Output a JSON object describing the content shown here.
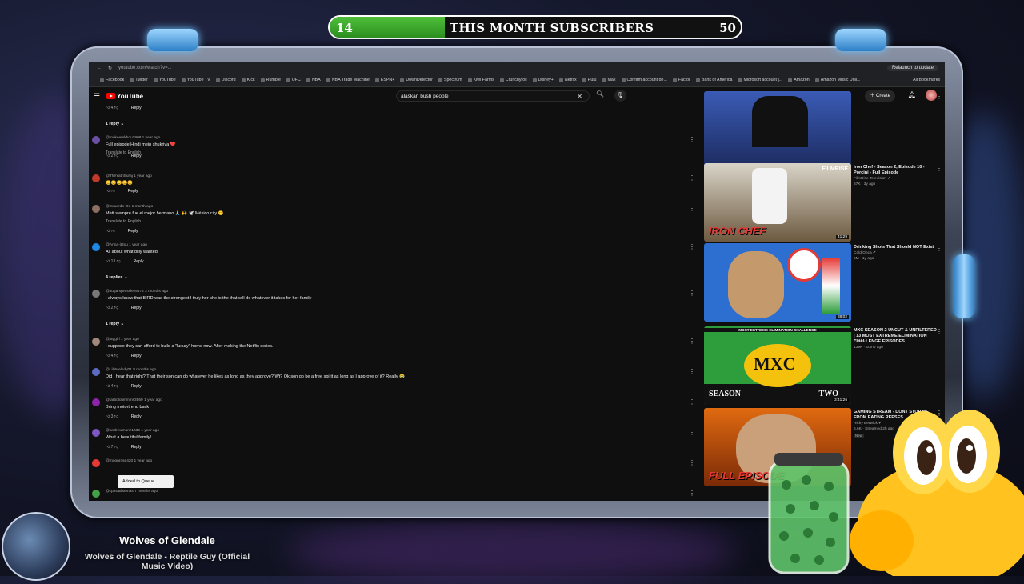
{
  "overlay": {
    "subscribers": {
      "current": "14",
      "title": "THIS MONTH SUBSCRIBERS",
      "goal": "50",
      "progress_fraction": 0.28
    },
    "now_playing": {
      "title": "Wolves of Glendale",
      "subtitle": "Wolves of Glendale - Reptile Guy (Official Music Video)"
    }
  },
  "browser": {
    "url": "youtube.com/watch?v=...",
    "relaunch_label": "Relaunch to update",
    "bookmarks": [
      "Facebook",
      "Twitter",
      "YouTube",
      "YouTube TV",
      "Discord",
      "Kick",
      "Rumble",
      "UFC",
      "NBA",
      "NBA Trade Machine",
      "ESPN+",
      "DownDetector",
      "Spectrum",
      "Kiwi Farms",
      "Crunchyroll",
      "Disney+",
      "Netflix",
      "Hulu",
      "Max",
      "Confirm account de...",
      "Factor",
      "Bank of America",
      "Microsoft account |...",
      "Amazon",
      "Amazon Music Unli..."
    ],
    "all_bookmarks_label": "All Bookmarks"
  },
  "youtube": {
    "logo": "YouTube",
    "search_value": "alaskan bush people",
    "create_label": "Create",
    "comments": [
      {
        "author": "",
        "text": "",
        "actions": "4",
        "reply": "Reply",
        "thread": "1 reply"
      },
      {
        "author": "@mokeemkhou1908  1 year ago",
        "text": "Full episode Hindi mein shukriya ❤️",
        "translate": "Translate to English",
        "actions": "2",
        "reply": "Reply",
        "av": "#6a4fa3"
      },
      {
        "author": "@TheYatriSuraj  1 year ago",
        "text": "😊😊😊😊😊",
        "actions": "",
        "reply": "Reply",
        "av": "#c0392b"
      },
      {
        "author": "@Eduardo-t9q  1 month ago",
        "text": "Matt siempre fue el mejor hermano 🙏 🙌 🕊️ México city 😊",
        "translate": "Translate to English",
        "actions": "",
        "reply": "Reply",
        "av": "#8d6e63"
      },
      {
        "author": "@Anna-jt2xu  1 year ago",
        "text": "All about what billy wanted",
        "actions": "13",
        "reply": "Reply",
        "av": "#1e88e5",
        "thread": "4 replies"
      },
      {
        "author": "@sugarspressley9472  2 months ago",
        "text": "I always knew that BIRD was the strongest  I truly her she is the that will do whatever it takes for her family",
        "actions": "2",
        "reply": "Reply",
        "av": "#777",
        "thread": "1 reply"
      },
      {
        "author": "@jaggirl  1 year ago",
        "text": "I suppose they can afford to build a \"luxury\" home now. After making the Netflix series.",
        "actions": "4",
        "reply": "Reply",
        "av": "#a1887f"
      },
      {
        "author": "@LilyMelody01  8 months ago",
        "text": "Did I hear that right? That their son can do whatever he likes as long as they approve? Wt? Ok son go be a free spirit as long as I approve of it? Really 😂",
        "actions": "4",
        "reply": "Reply",
        "av": "#5c6bc0"
      },
      {
        "author": "@tarbolcummins3569  1 year ago",
        "text": "Bring motortrend back",
        "actions": "3",
        "reply": "Reply",
        "av": "#8e24aa"
      },
      {
        "author": "@andrewmunz1639  1 year ago",
        "text": "What a beautiful family!",
        "actions": "7",
        "reply": "Reply",
        "av": "#7e57c2"
      },
      {
        "author": "@moonrose420  1 year ago",
        "text": "",
        "actions": "",
        "reply": "",
        "av": "#e53935"
      },
      {
        "author": "@cparadisemas  7 months ago",
        "text": "",
        "actions": "",
        "reply": "",
        "av": "#43a047"
      }
    ],
    "toast": "Added to Queue",
    "sidebar": [
      {
        "title": "",
        "channel": "",
        "meta": "",
        "duration": ""
      },
      {
        "title": "Iron Chef - Season 2, Episode 10 - Porcini - Full Episode",
        "channel": "FilmRise Television ✔",
        "meta": "57K · 3y ago",
        "duration": "41:29",
        "thumb_text": "IRON CHEF",
        "brand": "FILMRISE"
      },
      {
        "title": "Drinking Shots That Should NOT Exist",
        "channel": "Cold Onca ✔",
        "meta": "5M · 1y ago",
        "duration": "38:02"
      },
      {
        "title": "MXC SEASON 2 UNCUT & UNFILTERED | 13 MOST EXTREME ELIMINATION CHALLENGE EPISODES",
        "channel": "CONtv",
        "meta": "139K · 10mo ago",
        "duration": "3:41:26",
        "thumb_top": "MOST EXTREME ELIMINATION CHALLENGE",
        "thumb_left": "SEASON",
        "thumb_right": "TWO",
        "thumb_logo": "MXC"
      },
      {
        "title": "GAMING STREAM - DONT STOP ME FROM EATING REESES",
        "channel": "Ricky Berwick ✔",
        "meta": "6.6K · Streamed 2h ago",
        "badge": "New",
        "thumb_text": "FULL EPISODE"
      }
    ]
  },
  "colors": {
    "yt_bg": "#0f0f0f",
    "accent_red": "#ff0000",
    "sub_fill": "#3fae2f"
  }
}
